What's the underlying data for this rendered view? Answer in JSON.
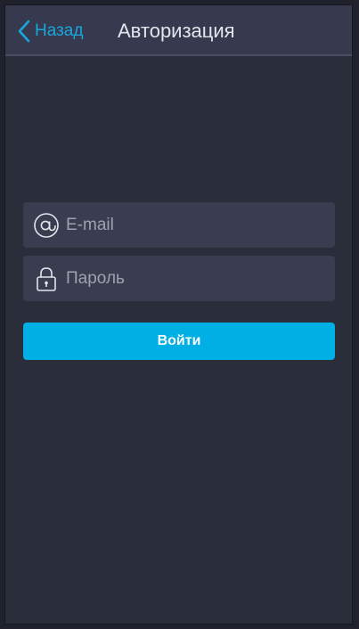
{
  "header": {
    "back_label": "Назад",
    "title": "Авторизация"
  },
  "form": {
    "email": {
      "placeholder": "E-mail",
      "value": "",
      "icon": "at-icon"
    },
    "password": {
      "placeholder": "Пароль",
      "value": "",
      "icon": "lock-icon"
    },
    "submit_label": "Войти"
  },
  "colors": {
    "accent": "#00afe3",
    "back_link": "#16a8dc",
    "background": "#2a2d3a",
    "header": "#373a4e",
    "field": "#3a3d50"
  }
}
